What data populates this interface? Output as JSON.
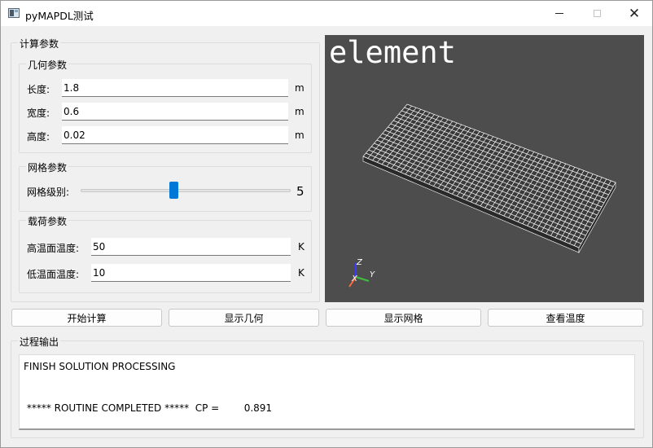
{
  "window": {
    "title": "pyMAPDL测试",
    "controls": {
      "minimize": "—",
      "maximize": "☐",
      "close": "✕"
    }
  },
  "params": {
    "title": "计算参数",
    "geometry": {
      "title": "几何参数",
      "length": {
        "label": "长度:",
        "value": "1.8",
        "unit": "m"
      },
      "width": {
        "label": "宽度:",
        "value": "0.6",
        "unit": "m"
      },
      "height": {
        "label": "高度:",
        "value": "0.02",
        "unit": "m"
      }
    },
    "mesh": {
      "title": "网格参数",
      "level": {
        "label": "网格级别:",
        "value": "5",
        "fraction": 0.44
      }
    },
    "load": {
      "title": "载荷参数",
      "high_temp": {
        "label": "高温面温度:",
        "value": "50",
        "unit": "K"
      },
      "low_temp": {
        "label": "低温面温度:",
        "value": "10",
        "unit": "K"
      }
    }
  },
  "viewport": {
    "title": "element",
    "background": "#4d4d4d",
    "mesh_color": "#ffffff",
    "axes": {
      "z": "Z",
      "y": "Y",
      "x": "X"
    },
    "axis_colors": {
      "z": "#3a3aff",
      "y": "#3fbf3f",
      "x": "#ff6a3a"
    }
  },
  "buttons": {
    "start": "开始计算",
    "show_geometry": "显示几何",
    "show_mesh": "显示网格",
    "view_temp": "查看温度"
  },
  "output": {
    "title": "过程输出",
    "lines": [
      "FINISH SOLUTION PROCESSING",
      "",
      "",
      " ***** ROUTINE COMPLETED *****  CP =        0.891"
    ]
  },
  "colors": {
    "accent": "#0078d7"
  }
}
